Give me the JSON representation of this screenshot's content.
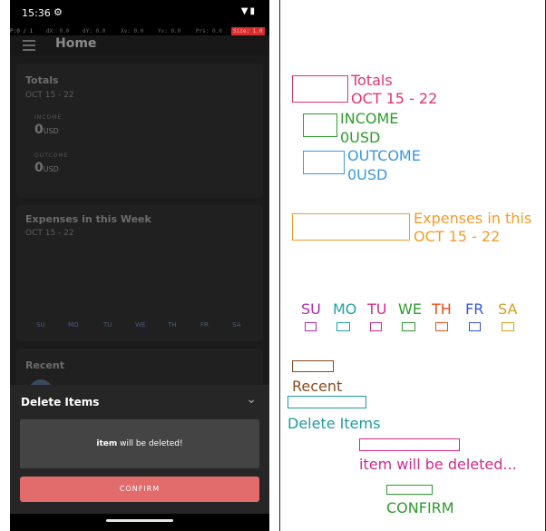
{
  "status_bar": {
    "time": "15:36",
    "gear_icon": "⚙",
    "signal_icons": "▼▮"
  },
  "debug_bar": {
    "pointer": "P:0 / 1",
    "dx": "dX: 0.0",
    "dy": "dY: 0.0",
    "xv": "Xv: 0.0",
    "yv": "Yv: 0.0",
    "prs": "Prs: 0.0",
    "size": "Size: 1.0"
  },
  "app_bar": {
    "title": "Home"
  },
  "totals": {
    "title": "Totals",
    "date_range": "OCT 15 - 22",
    "income_label": "INCOME",
    "income_value": "0",
    "outcome_label": "OUTCOME",
    "outcome_value": "0",
    "currency": "USD"
  },
  "expenses": {
    "title": "Expenses in this Week",
    "date_range": "OCT 15 - 22",
    "days": [
      "SU",
      "MO",
      "TU",
      "WE",
      "TH",
      "FR",
      "SA"
    ]
  },
  "recent": {
    "title": "Recent"
  },
  "delete_sheet": {
    "title": "Delete Items",
    "message_item": "item",
    "message_rest": " will be deleted!",
    "confirm_label": "CONFIRM"
  },
  "annotations": {
    "totals": "Totals",
    "totals_date": "OCT 15 - 22",
    "income": "INCOME",
    "income_value": "0USD",
    "outcome": "OUTCOME",
    "outcome_value": "0USD",
    "expenses": "Expenses in this",
    "expenses_date": "OCT 15 - 22",
    "days": [
      "SU",
      "MO",
      "TU",
      "WE",
      "TH",
      "FR",
      "SA"
    ],
    "recent": "Recent",
    "delete_items": "Delete Items",
    "message": "item will be deleted...",
    "confirm": "CONFIRM"
  },
  "colors": {
    "confirm": "#e26b6b",
    "annot_totals": "#e0346e",
    "annot_income": "#2e9b2e",
    "annot_outcome": "#3d97e0",
    "annot_expenses": "#f39c2a",
    "annot_recent": "#8b4a1f",
    "annot_delete": "#1f9aa0",
    "annot_message": "#d02a8a",
    "annot_confirm": "#2e9b2e"
  }
}
